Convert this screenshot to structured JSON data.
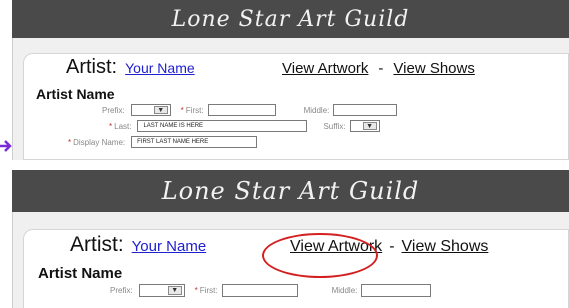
{
  "colors": {
    "banner": "#4a4a4a",
    "link": "#2020d0",
    "required": "#c03030",
    "highlight": "#d42020",
    "corner": "#e06a00",
    "arrow": "#7a2ad8"
  },
  "top": {
    "site_title": "Lone Star Art Guild",
    "artist_label": "Artist:",
    "your_name_link": "Your Name",
    "view_artwork_link": "View Artwork",
    "nav_separator": "-",
    "view_shows_link": "View Shows",
    "section_title": "Artist Name",
    "fields": {
      "prefix_label": "Prefix:",
      "first_label": "First:",
      "middle_label": "Middle:",
      "last_label": "Last:",
      "last_value": "LAST NAME IS HERE",
      "suffix_label": "Suffix:",
      "display_name_label": "Display Name:",
      "display_name_value": "FIRST LAST NAME HERE",
      "required_marker": "*"
    }
  },
  "bottom": {
    "site_title": "Lone Star Art Guild",
    "artist_label": "Artist:",
    "your_name_link": "Your Name",
    "view_artwork_link": "View Artwork",
    "nav_separator": "-",
    "view_shows_link": "View Shows",
    "section_title": "Artist Name",
    "fields": {
      "prefix_label": "Prefix:",
      "first_label": "First:",
      "middle_label": "Middle:",
      "required_marker": "*"
    }
  },
  "icons": {
    "select_arrow": "chevron-down-icon",
    "side_arrow": "arrow-right-icon"
  }
}
